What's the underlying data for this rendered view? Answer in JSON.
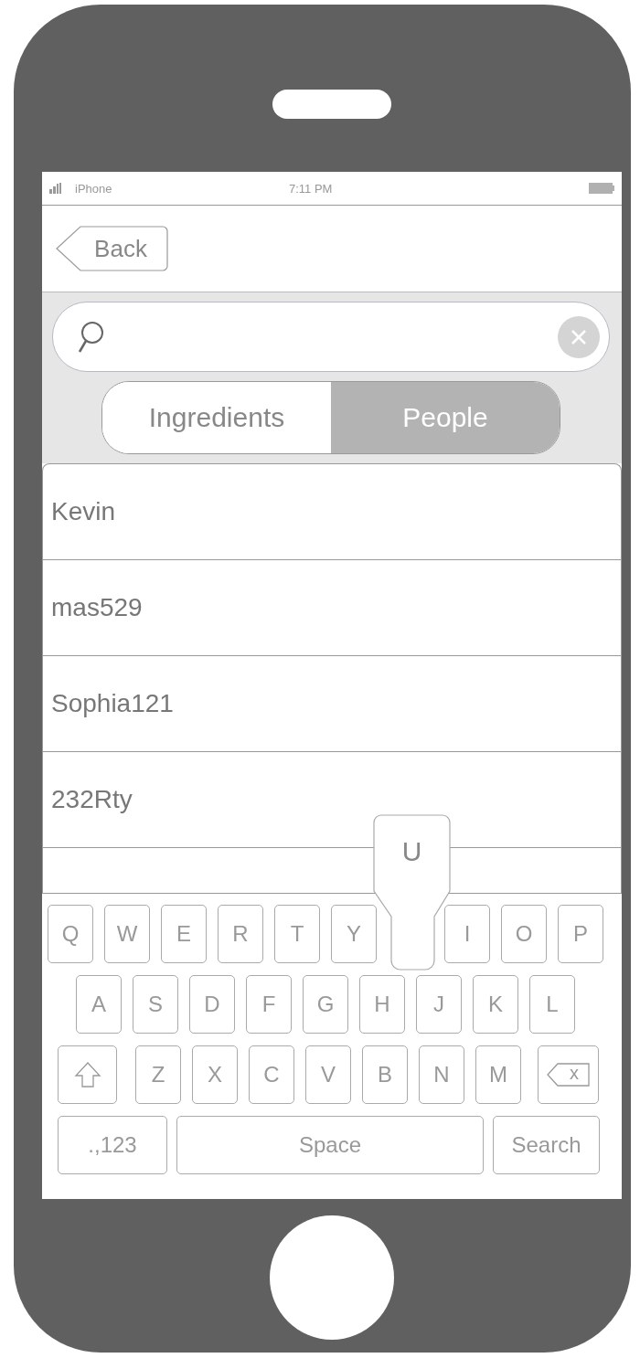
{
  "status_bar": {
    "carrier": "iPhone",
    "time": "7:11 PM"
  },
  "nav": {
    "back": "Back"
  },
  "segments": [
    {
      "label": "Ingredients",
      "selected": false
    },
    {
      "label": "People",
      "selected": true
    }
  ],
  "results": [
    {
      "name": "Kevin"
    },
    {
      "name": "mas529"
    },
    {
      "name": "Sophia121"
    },
    {
      "name": "232Rty"
    }
  ],
  "keyboard": {
    "rows": [
      {
        "keys": [
          {
            "kind": "letter",
            "label": "Q"
          },
          {
            "kind": "letter",
            "label": "W"
          },
          {
            "kind": "letter",
            "label": "E"
          },
          {
            "kind": "letter",
            "label": "R"
          },
          {
            "kind": "letter",
            "label": "T"
          },
          {
            "kind": "letter",
            "label": "Y"
          },
          {
            "kind": "letter",
            "label": "U",
            "pressed": true
          },
          {
            "kind": "letter",
            "label": "I"
          },
          {
            "kind": "letter",
            "label": "O"
          },
          {
            "kind": "letter",
            "label": "P"
          }
        ]
      },
      {
        "keys": [
          {
            "kind": "letter",
            "label": "A"
          },
          {
            "kind": "letter",
            "label": "S"
          },
          {
            "kind": "letter",
            "label": "D"
          },
          {
            "kind": "letter",
            "label": "F"
          },
          {
            "kind": "letter",
            "label": "G"
          },
          {
            "kind": "letter",
            "label": "H"
          },
          {
            "kind": "letter",
            "label": "J"
          },
          {
            "kind": "letter",
            "label": "K"
          },
          {
            "kind": "letter",
            "label": "L"
          }
        ]
      },
      {
        "keys": [
          {
            "kind": "shift"
          },
          {
            "kind": "letter",
            "label": "Z"
          },
          {
            "kind": "letter",
            "label": "X"
          },
          {
            "kind": "letter",
            "label": "C"
          },
          {
            "kind": "letter",
            "label": "V"
          },
          {
            "kind": "letter",
            "label": "B"
          },
          {
            "kind": "letter",
            "label": "N"
          },
          {
            "kind": "letter",
            "label": "M"
          },
          {
            "kind": "backspace",
            "label": "x"
          }
        ]
      },
      {
        "keys": [
          {
            "kind": "numbers",
            "label": ".,123"
          },
          {
            "kind": "space",
            "label": "Space"
          },
          {
            "kind": "search",
            "label": "Search"
          }
        ]
      }
    ]
  }
}
